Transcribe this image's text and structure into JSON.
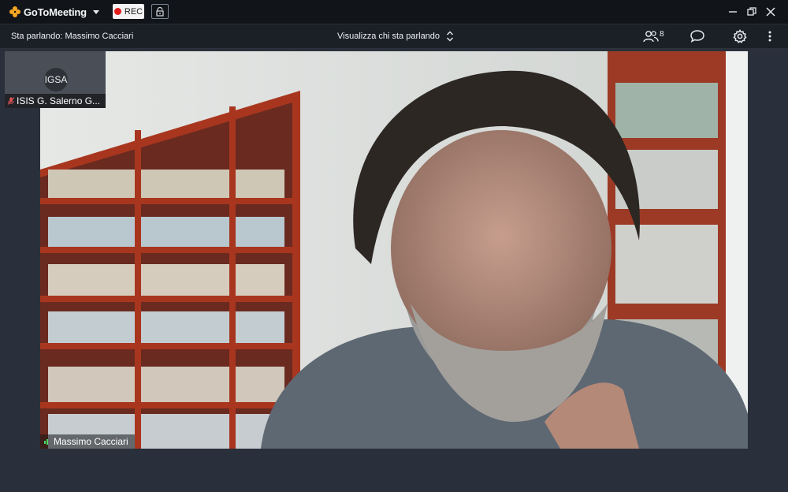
{
  "app": {
    "logo_text": "GoToMeeting",
    "rec_label": "REC",
    "brand_color": "#f6a623",
    "rec_color": "#e01b1b"
  },
  "toolbar": {
    "speaking_text": "Sta parlando: Massimo Cacciari",
    "view_mode_label": "Visualizza chi sta parlando",
    "attendee_count": "8"
  },
  "thumbnail": {
    "initials": "IGSA",
    "name": "ISIS G. Salerno G..."
  },
  "main_video": {
    "speaker_name": "Massimo Cacciari"
  },
  "icons": {
    "logo": "gotomeeting-flower-icon",
    "lock": "unlock-icon",
    "minimize": "minimize-icon",
    "restore": "restore-icon",
    "close": "close-icon",
    "view_toggle": "up-down-chevron-icon",
    "attendees": "people-icon",
    "chat": "chat-bubble-icon",
    "settings": "gear-icon",
    "more": "kebab-menu-icon",
    "mic_off": "mic-muted-icon",
    "audio": "audio-level-icon"
  }
}
